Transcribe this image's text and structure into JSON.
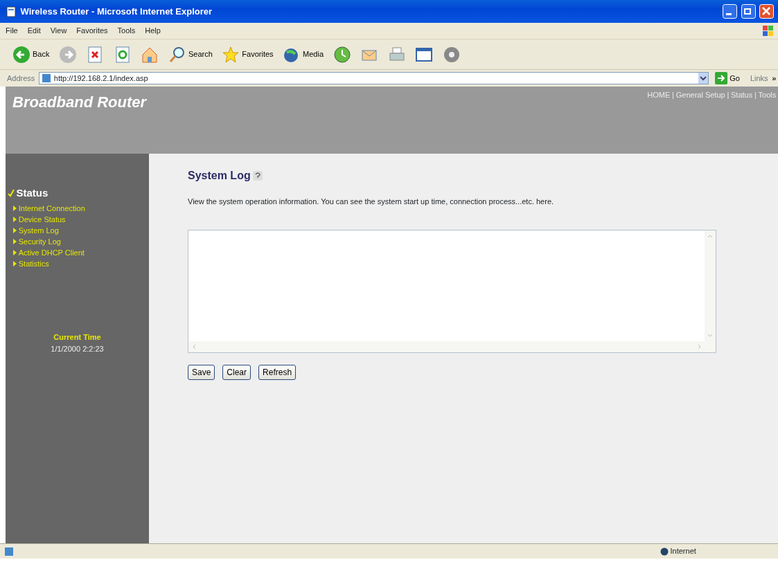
{
  "window": {
    "title": "Wireless Router - Microsoft Internet Explorer"
  },
  "menu": [
    "File",
    "Edit",
    "View",
    "Favorites",
    "Tools",
    "Help"
  ],
  "toolbar": [
    {
      "kind": "back",
      "label": "Back"
    },
    {
      "kind": "forward"
    },
    {
      "kind": "stop"
    },
    {
      "kind": "refresh"
    },
    {
      "kind": "home"
    },
    {
      "kind": "search",
      "label": "Search"
    },
    {
      "kind": "favorites",
      "label": "Favorites"
    },
    {
      "kind": "media",
      "label": "Media"
    },
    {
      "kind": "history"
    },
    {
      "kind": "mail"
    },
    {
      "kind": "print"
    },
    {
      "kind": "edit"
    },
    {
      "kind": "messenger"
    }
  ],
  "address_bar": {
    "label": "Address",
    "url": "http://192.168.2.1/index.asp",
    "go": "Go",
    "links": "Links",
    "more": "»"
  },
  "header": {
    "brand": "Broadband Router",
    "nav": [
      {
        "kind": "link",
        "text": "HOME"
      },
      {
        "kind": "separator",
        "text": "|"
      },
      {
        "kind": "link",
        "text": "General Setup"
      },
      {
        "kind": "separator",
        "text": "|"
      },
      {
        "kind": "link",
        "text": "Status"
      },
      {
        "kind": "separator",
        "text": "|"
      },
      {
        "kind": "link",
        "text": "Tools"
      }
    ]
  },
  "sidebar": {
    "section": "Status",
    "items": [
      "Internet Connection",
      "Device Status",
      "System Log",
      "Security Log",
      "Active DHCP Client",
      "Statistics"
    ],
    "time_label": "Current Time",
    "time_value": "1/1/2000 2:2:23"
  },
  "content": {
    "title": "System Log",
    "description": "View the system operation information. You can see the system start up time, connection process...etc. here.",
    "buttons": [
      "Save",
      "Clear",
      "Refresh"
    ]
  },
  "status_bar": {
    "zone": "Internet"
  }
}
